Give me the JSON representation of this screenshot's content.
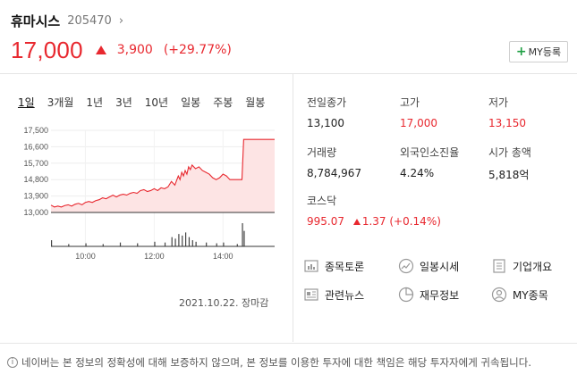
{
  "stock": {
    "name": "휴마시스",
    "code": "205470",
    "price": "17,000",
    "change_amount": "3,900",
    "change_percent": "(+29.77%)"
  },
  "my_button": {
    "label": "MY등록"
  },
  "tabs": [
    {
      "label": "1일",
      "active": true
    },
    {
      "label": "3개월",
      "active": false
    },
    {
      "label": "1년",
      "active": false
    },
    {
      "label": "3년",
      "active": false
    },
    {
      "label": "10년",
      "active": false
    },
    {
      "label": "일봉",
      "active": false
    },
    {
      "label": "주봉",
      "active": false
    },
    {
      "label": "월봉",
      "active": false
    }
  ],
  "chart_data": {
    "type": "line",
    "ylim": [
      13000,
      17500
    ],
    "yticks": [
      "17,500",
      "16,600",
      "15,700",
      "14,800",
      "13,900",
      "13,000"
    ],
    "ytick_values": [
      17500,
      16600,
      15700,
      14800,
      13900,
      13000
    ],
    "xticks": [
      "10:00",
      "12:00",
      "14:00"
    ],
    "xtick_values": [
      10,
      12,
      14
    ],
    "xlim": [
      9,
      15.5
    ],
    "previous_close": 13100,
    "series": [
      {
        "x": [
          9.0,
          9.1,
          9.2,
          9.3,
          9.4,
          9.5,
          9.6,
          9.7,
          9.8,
          9.9,
          10.0,
          10.1,
          10.2,
          10.3,
          10.4,
          10.5,
          10.6,
          10.7,
          10.8,
          10.9,
          11.0,
          11.1,
          11.2,
          11.3,
          11.4,
          11.5,
          11.6,
          11.7,
          11.8,
          11.9,
          12.0,
          12.1,
          12.2,
          12.3,
          12.4,
          12.5,
          12.6,
          12.7,
          12.75,
          12.8,
          12.85,
          12.9,
          12.95,
          13.0,
          13.05,
          13.1,
          13.2,
          13.3,
          13.4,
          13.5,
          13.6,
          13.7,
          13.8,
          13.9,
          14.0,
          14.1,
          14.2,
          14.3,
          14.4,
          14.5,
          14.55,
          14.6,
          14.8,
          15.0,
          15.2,
          15.5
        ],
        "values": [
          13400,
          13300,
          13350,
          13300,
          13380,
          13420,
          13350,
          13450,
          13500,
          13420,
          13550,
          13600,
          13550,
          13650,
          13700,
          13800,
          13750,
          13850,
          13950,
          13850,
          13950,
          14000,
          13950,
          14050,
          14100,
          14050,
          14200,
          14250,
          14150,
          14200,
          14300,
          14200,
          14350,
          14300,
          14400,
          14700,
          14500,
          15000,
          14800,
          15200,
          15000,
          15300,
          15100,
          15500,
          15350,
          15600,
          15400,
          15500,
          15300,
          15200,
          15100,
          14900,
          14800,
          14900,
          15100,
          15000,
          14800,
          14800,
          14800,
          14800,
          14800,
          17000,
          17000,
          17000,
          17000,
          17000
        ]
      }
    ],
    "volume": {
      "x": [
        9.0,
        9.5,
        10.0,
        10.5,
        11.0,
        11.5,
        12.0,
        12.3,
        12.5,
        12.6,
        12.7,
        12.8,
        12.9,
        13.0,
        13.1,
        13.2,
        13.5,
        13.8,
        14.0,
        14.4,
        14.55,
        14.6
      ],
      "values": [
        8,
        3,
        4,
        3,
        5,
        4,
        6,
        5,
        12,
        10,
        16,
        14,
        18,
        12,
        8,
        6,
        5,
        4,
        5,
        3,
        30,
        20
      ]
    },
    "date_label": "2021.10.22.",
    "status_label": "장마감"
  },
  "info": {
    "prev_close_label": "전일종가",
    "prev_close": "13,100",
    "high_label": "고가",
    "high": "17,000",
    "low_label": "저가",
    "low": "13,150",
    "volume_label": "거래량",
    "volume": "8,784,967",
    "foreign_label": "외국인소진율",
    "foreign": "4.24%",
    "mcap_label": "시가 총액",
    "mcap": "5,818억",
    "index_label": "코스닥",
    "index_value": "995.07",
    "index_change": "1.37 (+0.14%)"
  },
  "links": [
    {
      "label": "종목토론",
      "icon": "discussion-icon"
    },
    {
      "label": "일봉시세",
      "icon": "chart-icon"
    },
    {
      "label": "기업개요",
      "icon": "company-icon"
    },
    {
      "label": "관련뉴스",
      "icon": "news-icon"
    },
    {
      "label": "재무정보",
      "icon": "pie-icon"
    },
    {
      "label": "MY종목",
      "icon": "user-icon"
    }
  ],
  "notice": "네이버는 본 정보의 정확성에 대해 보증하지 않으며, 본 정보를 이용한 투자에 대한 책임은 해당 투자자에게 귀속됩니다.",
  "colors": {
    "up": "#e8282f",
    "accent_green": "#20a044"
  }
}
